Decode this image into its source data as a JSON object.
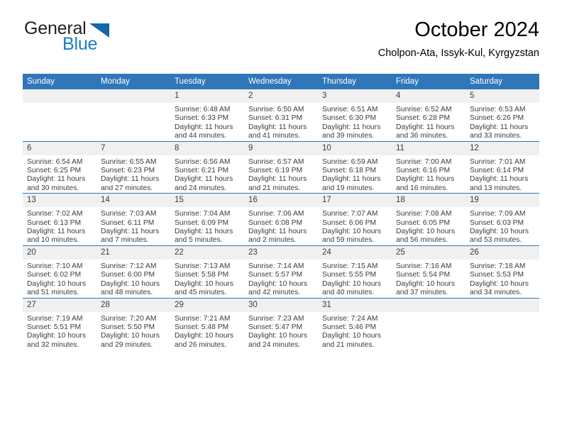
{
  "brand": {
    "name_part1": "General",
    "name_part2": "Blue",
    "logo_icon": "triangle-logo-icon"
  },
  "header": {
    "month_title": "October 2024",
    "location": "Cholpon-Ata, Issyk-Kul, Kyrgyzstan",
    "accent_color": "#2f77b8",
    "daynum_band_color": "#f0f0f0"
  },
  "weekdays": [
    "Sunday",
    "Monday",
    "Tuesday",
    "Wednesday",
    "Thursday",
    "Friday",
    "Saturday"
  ],
  "weeks": [
    [
      {
        "day": "",
        "lines": []
      },
      {
        "day": "",
        "lines": []
      },
      {
        "day": "1",
        "lines": [
          "Sunrise: 6:48 AM",
          "Sunset: 6:33 PM",
          "Daylight: 11 hours",
          "and 44 minutes."
        ]
      },
      {
        "day": "2",
        "lines": [
          "Sunrise: 6:50 AM",
          "Sunset: 6:31 PM",
          "Daylight: 11 hours",
          "and 41 minutes."
        ]
      },
      {
        "day": "3",
        "lines": [
          "Sunrise: 6:51 AM",
          "Sunset: 6:30 PM",
          "Daylight: 11 hours",
          "and 39 minutes."
        ]
      },
      {
        "day": "4",
        "lines": [
          "Sunrise: 6:52 AM",
          "Sunset: 6:28 PM",
          "Daylight: 11 hours",
          "and 36 minutes."
        ]
      },
      {
        "day": "5",
        "lines": [
          "Sunrise: 6:53 AM",
          "Sunset: 6:26 PM",
          "Daylight: 11 hours",
          "and 33 minutes."
        ]
      }
    ],
    [
      {
        "day": "6",
        "lines": [
          "Sunrise: 6:54 AM",
          "Sunset: 6:25 PM",
          "Daylight: 11 hours",
          "and 30 minutes."
        ]
      },
      {
        "day": "7",
        "lines": [
          "Sunrise: 6:55 AM",
          "Sunset: 6:23 PM",
          "Daylight: 11 hours",
          "and 27 minutes."
        ]
      },
      {
        "day": "8",
        "lines": [
          "Sunrise: 6:56 AM",
          "Sunset: 6:21 PM",
          "Daylight: 11 hours",
          "and 24 minutes."
        ]
      },
      {
        "day": "9",
        "lines": [
          "Sunrise: 6:57 AM",
          "Sunset: 6:19 PM",
          "Daylight: 11 hours",
          "and 21 minutes."
        ]
      },
      {
        "day": "10",
        "lines": [
          "Sunrise: 6:59 AM",
          "Sunset: 6:18 PM",
          "Daylight: 11 hours",
          "and 19 minutes."
        ]
      },
      {
        "day": "11",
        "lines": [
          "Sunrise: 7:00 AM",
          "Sunset: 6:16 PM",
          "Daylight: 11 hours",
          "and 16 minutes."
        ]
      },
      {
        "day": "12",
        "lines": [
          "Sunrise: 7:01 AM",
          "Sunset: 6:14 PM",
          "Daylight: 11 hours",
          "and 13 minutes."
        ]
      }
    ],
    [
      {
        "day": "13",
        "lines": [
          "Sunrise: 7:02 AM",
          "Sunset: 6:13 PM",
          "Daylight: 11 hours",
          "and 10 minutes."
        ]
      },
      {
        "day": "14",
        "lines": [
          "Sunrise: 7:03 AM",
          "Sunset: 6:11 PM",
          "Daylight: 11 hours",
          "and 7 minutes."
        ]
      },
      {
        "day": "15",
        "lines": [
          "Sunrise: 7:04 AM",
          "Sunset: 6:09 PM",
          "Daylight: 11 hours",
          "and 5 minutes."
        ]
      },
      {
        "day": "16",
        "lines": [
          "Sunrise: 7:06 AM",
          "Sunset: 6:08 PM",
          "Daylight: 11 hours",
          "and 2 minutes."
        ]
      },
      {
        "day": "17",
        "lines": [
          "Sunrise: 7:07 AM",
          "Sunset: 6:06 PM",
          "Daylight: 10 hours",
          "and 59 minutes."
        ]
      },
      {
        "day": "18",
        "lines": [
          "Sunrise: 7:08 AM",
          "Sunset: 6:05 PM",
          "Daylight: 10 hours",
          "and 56 minutes."
        ]
      },
      {
        "day": "19",
        "lines": [
          "Sunrise: 7:09 AM",
          "Sunset: 6:03 PM",
          "Daylight: 10 hours",
          "and 53 minutes."
        ]
      }
    ],
    [
      {
        "day": "20",
        "lines": [
          "Sunrise: 7:10 AM",
          "Sunset: 6:02 PM",
          "Daylight: 10 hours",
          "and 51 minutes."
        ]
      },
      {
        "day": "21",
        "lines": [
          "Sunrise: 7:12 AM",
          "Sunset: 6:00 PM",
          "Daylight: 10 hours",
          "and 48 minutes."
        ]
      },
      {
        "day": "22",
        "lines": [
          "Sunrise: 7:13 AM",
          "Sunset: 5:58 PM",
          "Daylight: 10 hours",
          "and 45 minutes."
        ]
      },
      {
        "day": "23",
        "lines": [
          "Sunrise: 7:14 AM",
          "Sunset: 5:57 PM",
          "Daylight: 10 hours",
          "and 42 minutes."
        ]
      },
      {
        "day": "24",
        "lines": [
          "Sunrise: 7:15 AM",
          "Sunset: 5:55 PM",
          "Daylight: 10 hours",
          "and 40 minutes."
        ]
      },
      {
        "day": "25",
        "lines": [
          "Sunrise: 7:16 AM",
          "Sunset: 5:54 PM",
          "Daylight: 10 hours",
          "and 37 minutes."
        ]
      },
      {
        "day": "26",
        "lines": [
          "Sunrise: 7:18 AM",
          "Sunset: 5:53 PM",
          "Daylight: 10 hours",
          "and 34 minutes."
        ]
      }
    ],
    [
      {
        "day": "27",
        "lines": [
          "Sunrise: 7:19 AM",
          "Sunset: 5:51 PM",
          "Daylight: 10 hours",
          "and 32 minutes."
        ]
      },
      {
        "day": "28",
        "lines": [
          "Sunrise: 7:20 AM",
          "Sunset: 5:50 PM",
          "Daylight: 10 hours",
          "and 29 minutes."
        ]
      },
      {
        "day": "29",
        "lines": [
          "Sunrise: 7:21 AM",
          "Sunset: 5:48 PM",
          "Daylight: 10 hours",
          "and 26 minutes."
        ]
      },
      {
        "day": "30",
        "lines": [
          "Sunrise: 7:23 AM",
          "Sunset: 5:47 PM",
          "Daylight: 10 hours",
          "and 24 minutes."
        ]
      },
      {
        "day": "31",
        "lines": [
          "Sunrise: 7:24 AM",
          "Sunset: 5:46 PM",
          "Daylight: 10 hours",
          "and 21 minutes."
        ]
      },
      {
        "day": "",
        "lines": []
      },
      {
        "day": "",
        "lines": []
      }
    ]
  ]
}
